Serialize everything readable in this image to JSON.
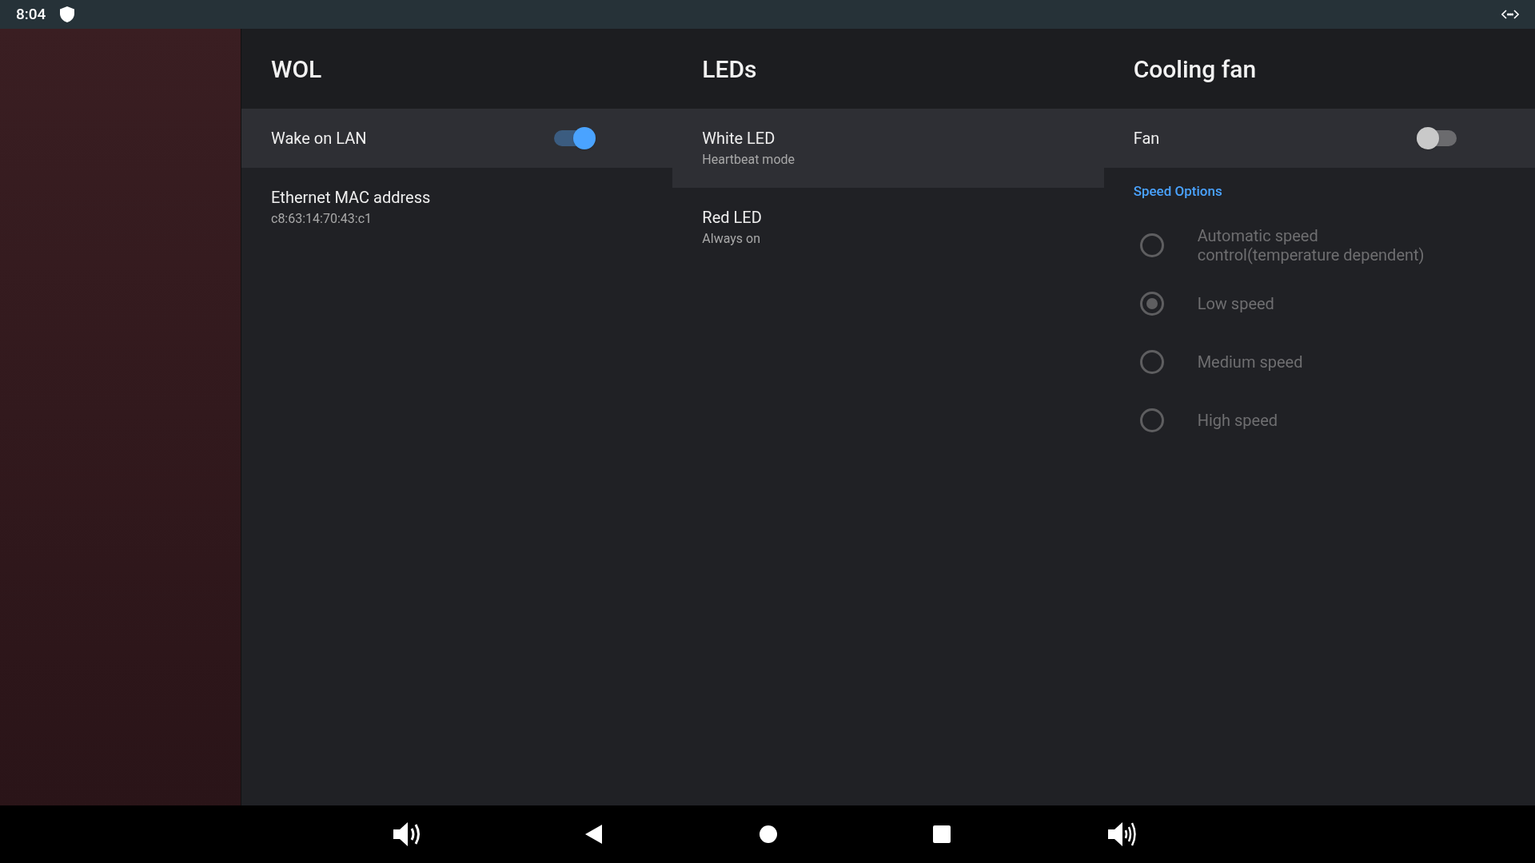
{
  "status_bar": {
    "time": "8:04"
  },
  "columns": [
    {
      "title": "WOL",
      "items": [
        {
          "kind": "switch",
          "label": "Wake on LAN",
          "on": true,
          "highlighted": true
        },
        {
          "kind": "info",
          "label": "Ethernet MAC address",
          "value": "c8:63:14:70:43:c1",
          "highlighted": false
        }
      ]
    },
    {
      "title": "LEDs",
      "items": [
        {
          "kind": "info",
          "label": "White LED",
          "value": "Heartbeat mode",
          "highlighted": true
        },
        {
          "kind": "info",
          "label": "Red LED",
          "value": "Always on",
          "highlighted": false
        }
      ]
    },
    {
      "title": "Cooling fan",
      "items": [
        {
          "kind": "switch",
          "label": "Fan",
          "on": false,
          "highlighted": true
        },
        {
          "kind": "category",
          "label": "Speed Options"
        },
        {
          "kind": "radio",
          "label": "Automatic speed control(temperature dependent)",
          "selected": false,
          "disabled": true
        },
        {
          "kind": "radio",
          "label": "Low speed",
          "selected": true,
          "disabled": true
        },
        {
          "kind": "radio",
          "label": "Medium speed",
          "selected": false,
          "disabled": true
        },
        {
          "kind": "radio",
          "label": "High speed",
          "selected": false,
          "disabled": true
        }
      ]
    }
  ]
}
